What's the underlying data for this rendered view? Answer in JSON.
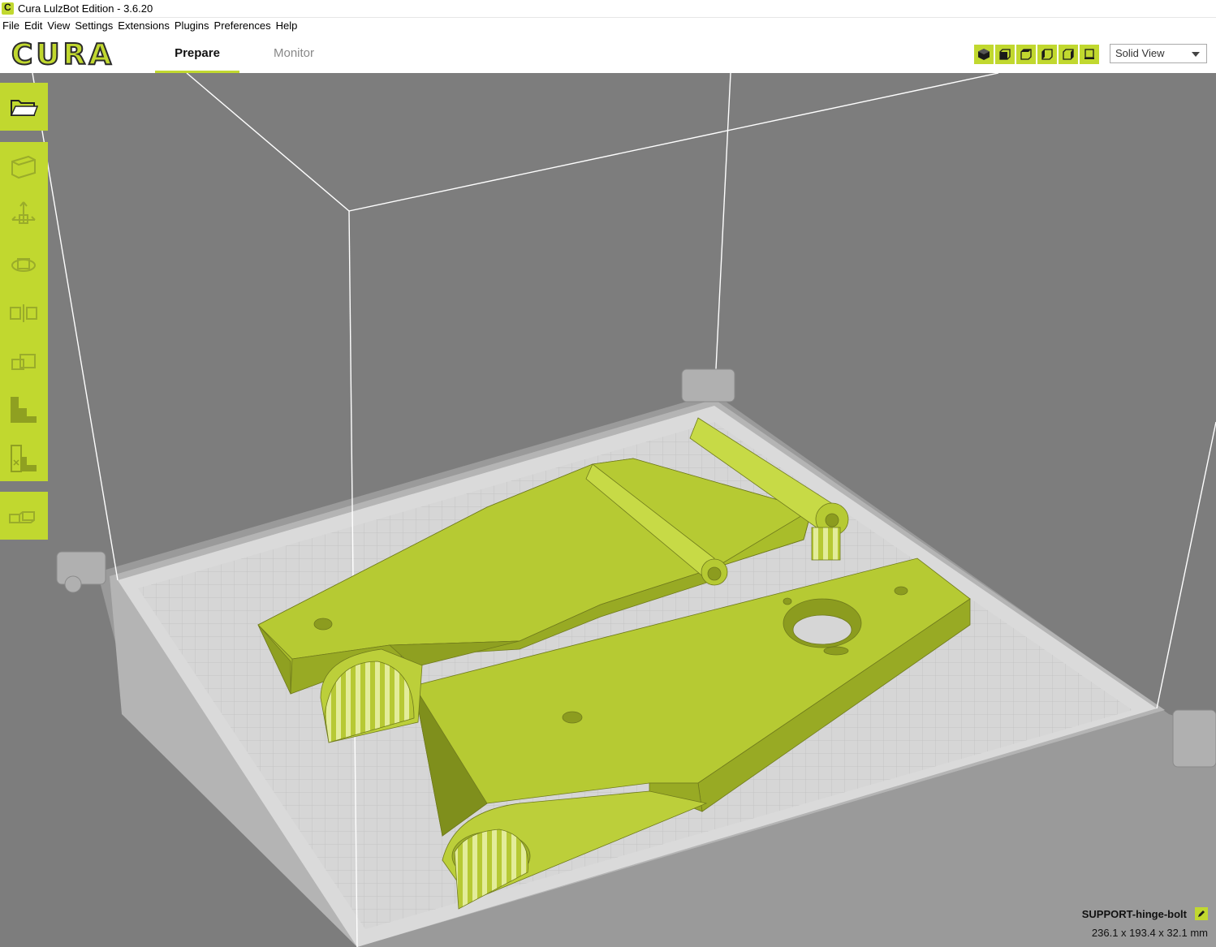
{
  "window": {
    "title": "Cura LulzBot Edition - 3.6.20"
  },
  "menu": [
    "File",
    "Edit",
    "View",
    "Settings",
    "Extensions",
    "Plugins",
    "Preferences",
    "Help"
  ],
  "header": {
    "logo": "CURA",
    "tabs": [
      {
        "label": "Prepare",
        "active": true
      },
      {
        "label": "Monitor",
        "active": false
      }
    ],
    "view_buttons": [
      "3d-view-icon",
      "front-view-icon",
      "top-view-icon",
      "left-view-icon",
      "right-view-icon",
      "x-ray-view-icon"
    ],
    "view_mode": "Solid View"
  },
  "toolbar": {
    "items": [
      "open-file-icon",
      "per-model-settings-icon",
      "move-icon",
      "rotate-icon",
      "mirror-icon",
      "scale-icon",
      "support-blocker-icon",
      "custom-support-icon",
      "duplicate-icon"
    ]
  },
  "object": {
    "name": "SUPPORT-hinge-bolt",
    "dimensions": "236.1 x 193.4 x 32.1 mm"
  },
  "colors": {
    "accent": "#c1d82f",
    "model": "#bccf3a",
    "background": "#7d7d7d",
    "bed": "#d9d9d9"
  }
}
